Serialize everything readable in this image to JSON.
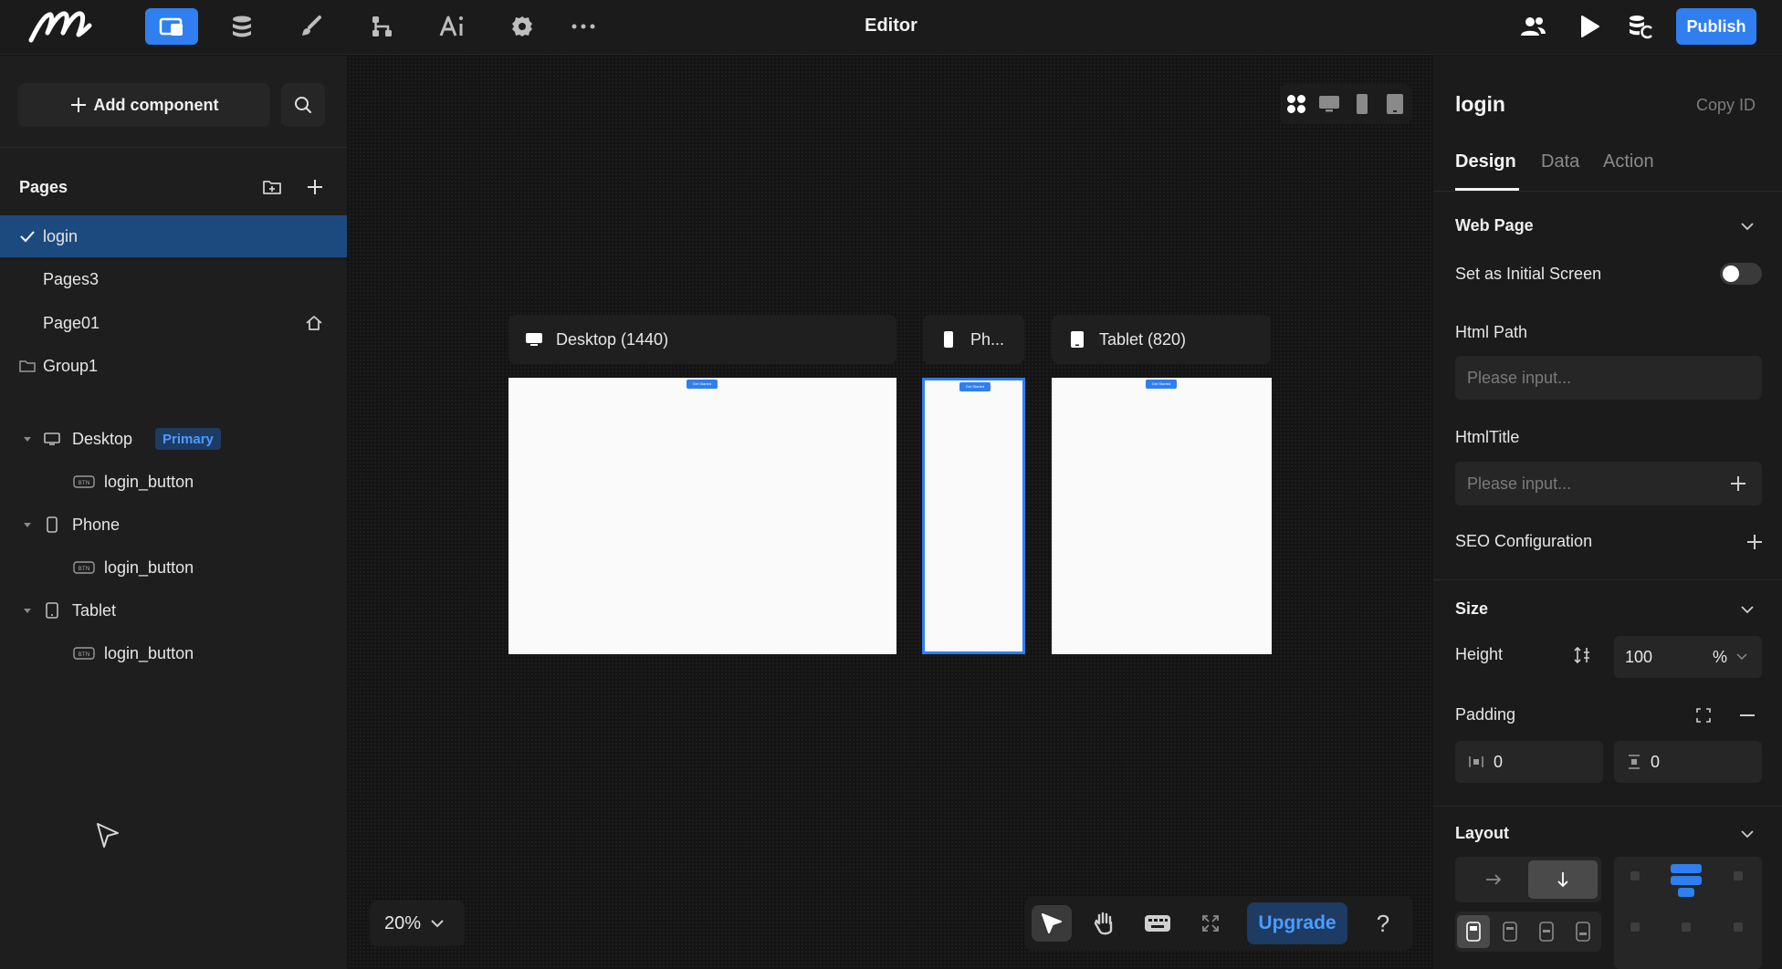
{
  "topbar": {
    "title": "Editor",
    "publish_label": "Publish",
    "nav_icons": [
      "pages-icon",
      "database-icon",
      "brush-icon",
      "workflow-icon",
      "ai-icon",
      "settings-icon",
      "more-icon"
    ],
    "active_nav": "pages-icon"
  },
  "left": {
    "add_component_label": "Add component",
    "pages_title": "Pages",
    "pages": [
      {
        "label": "login",
        "selected": true
      },
      {
        "label": "Pages3"
      },
      {
        "label": "Page01",
        "home": true
      },
      {
        "label": "Group1",
        "type": "folder"
      }
    ],
    "tree": [
      {
        "label": "Desktop",
        "badge": "Primary",
        "icon": "desktop-icon",
        "child": "login_button"
      },
      {
        "label": "Phone",
        "icon": "phone-icon",
        "child": "login_button"
      },
      {
        "label": "Tablet",
        "icon": "tablet-icon",
        "child": "login_button"
      }
    ]
  },
  "canvas": {
    "frames": [
      {
        "label": "Desktop (1440)",
        "icon": "desktop-icon"
      },
      {
        "label": "Ph...",
        "icon": "phone-icon"
      },
      {
        "label": "Tablet (820)",
        "icon": "tablet-icon"
      }
    ],
    "mini_button_label": "Get Started",
    "zoom": "20%",
    "upgrade_label": "Upgrade",
    "help_label": "?"
  },
  "right": {
    "title": "login",
    "copy_id_label": "Copy ID",
    "tabs": [
      "Design",
      "Data",
      "Action"
    ],
    "active_tab": "Design",
    "web_page": {
      "title": "Web Page",
      "initial_screen_label": "Set as Initial Screen",
      "initial_screen_on": false,
      "html_path_label": "Html Path",
      "html_path_placeholder": "Please input...",
      "html_title_label": "HtmlTitle",
      "html_title_placeholder": "Please input...",
      "seo_label": "SEO Configuration"
    },
    "size": {
      "title": "Size",
      "height_label": "Height",
      "height_value": "100",
      "height_unit": "%",
      "padding_label": "Padding",
      "padding_horizontal": "0",
      "padding_vertical": "0"
    },
    "layout": {
      "title": "Layout",
      "direction": "vertical"
    }
  },
  "colors": {
    "accent": "#2f7ff0",
    "selected_row": "#1d4a7e",
    "badge_text": "#4d9bff"
  }
}
